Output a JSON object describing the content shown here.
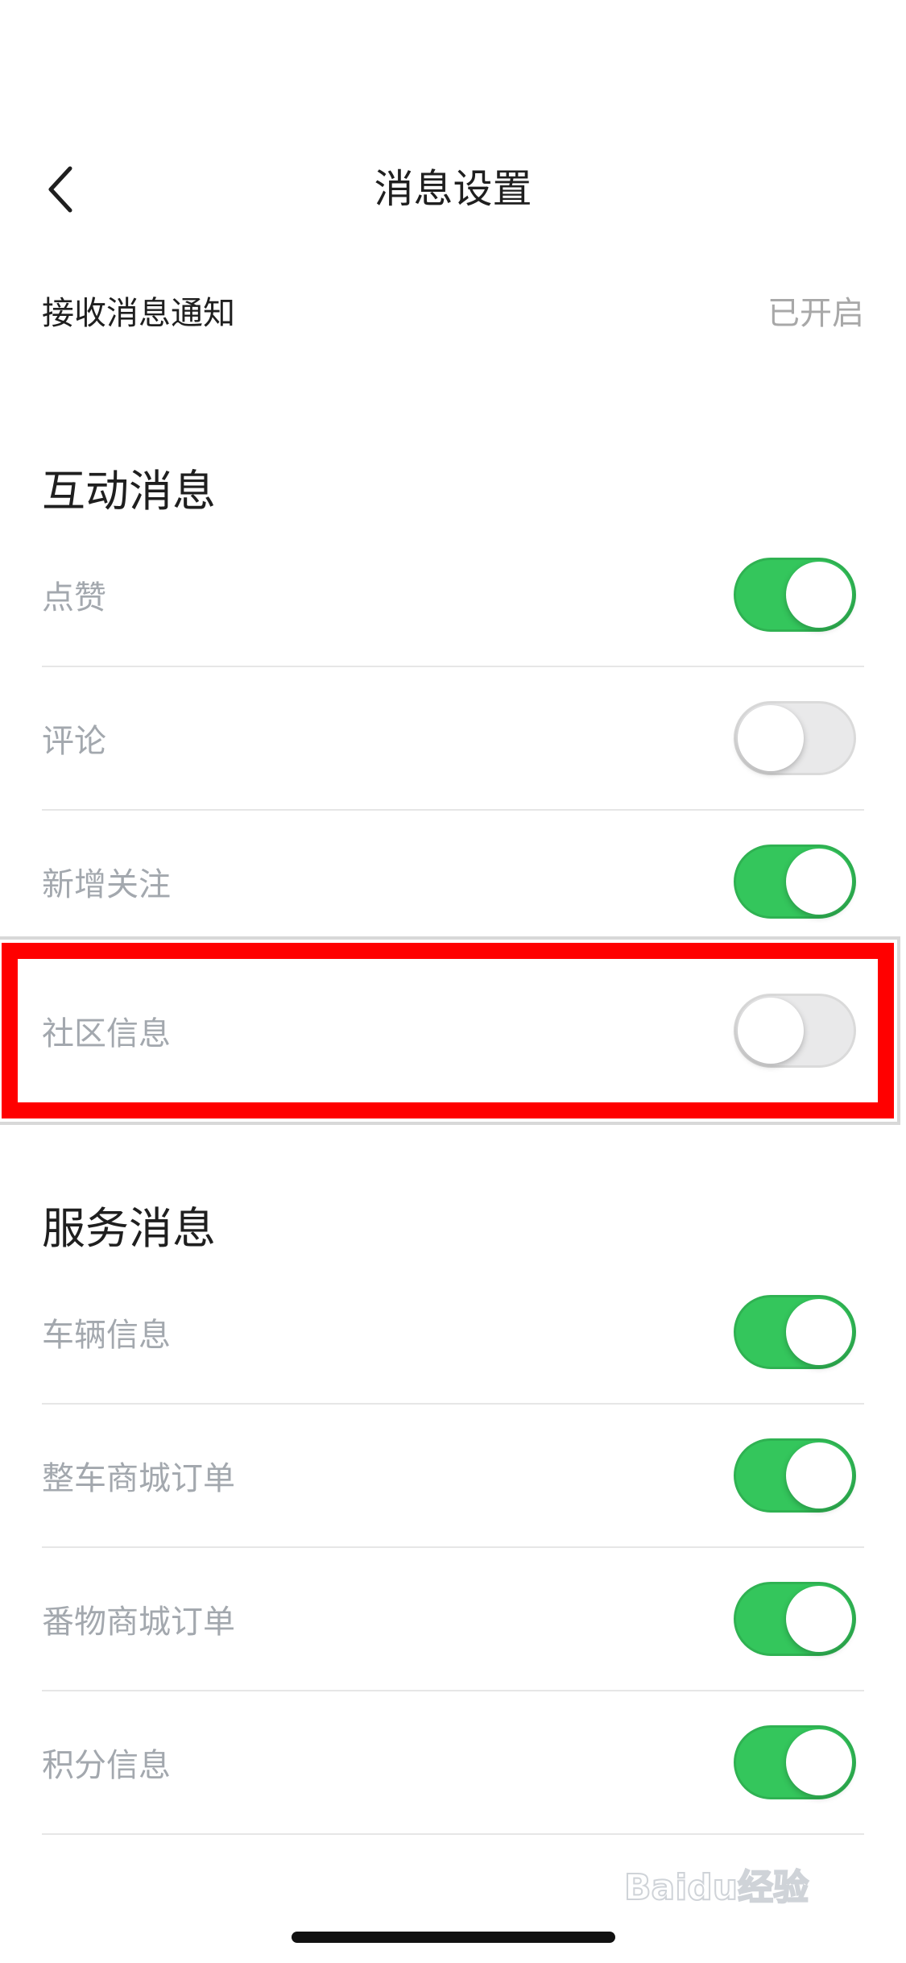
{
  "header": {
    "title": "消息设置",
    "back_icon": "chevron-left-icon"
  },
  "notifications": {
    "label": "接收消息通知",
    "status": "已开启"
  },
  "sections": {
    "interaction": {
      "title": "互动消息",
      "items": [
        {
          "label": "点赞",
          "enabled": true
        },
        {
          "label": "评论",
          "enabled": false
        },
        {
          "label": "新增关注",
          "enabled": true
        },
        {
          "label": "社区信息",
          "enabled": false
        }
      ]
    },
    "service": {
      "title": "服务消息",
      "items": [
        {
          "label": "车辆信息",
          "enabled": true
        },
        {
          "label": "整车商城订单",
          "enabled": true
        },
        {
          "label": "番物商城订单",
          "enabled": true
        },
        {
          "label": "积分信息",
          "enabled": true
        }
      ]
    }
  },
  "colors": {
    "toggle_on": "#34c65c",
    "toggle_off": "#e9e9ea",
    "highlight": "#ff0000",
    "label_gray": "#a3a8ae"
  },
  "watermark": {
    "text": "Baidu经验"
  }
}
